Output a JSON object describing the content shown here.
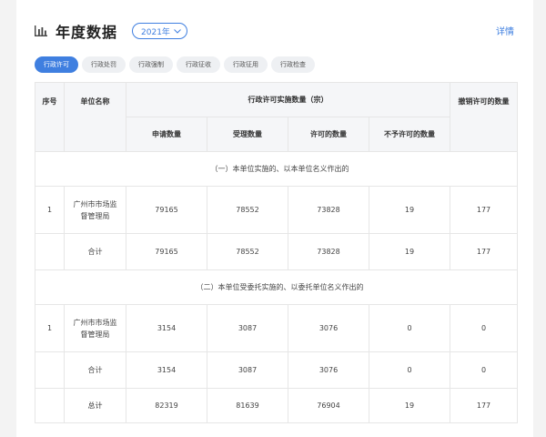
{
  "header": {
    "title": "年度数据",
    "year": "2021年",
    "detail_link": "详情"
  },
  "tabs": [
    {
      "label": "行政许可",
      "active": true
    },
    {
      "label": "行政处罚",
      "active": false
    },
    {
      "label": "行政强制",
      "active": false
    },
    {
      "label": "行政征收",
      "active": false
    },
    {
      "label": "行政征用",
      "active": false
    },
    {
      "label": "行政检查",
      "active": false
    }
  ],
  "table": {
    "headers": {
      "seq": "序号",
      "unit": "单位名称",
      "group": "行政许可实施数量（宗）",
      "apply": "申请数量",
      "accept": "受理数量",
      "permit": "许可的数量",
      "deny": "不予许可的数量",
      "revoke": "撤销许可的数量"
    },
    "sections": [
      {
        "title": "（一）本单位实施的、以本单位名义作出的",
        "row": {
          "seq": "1",
          "unit": "广州市市场监督管理局",
          "apply": "79165",
          "accept": "78552",
          "permit": "73828",
          "deny": "19",
          "revoke": "177"
        },
        "subtotal": {
          "label": "合计",
          "apply": "79165",
          "accept": "78552",
          "permit": "73828",
          "deny": "19",
          "revoke": "177"
        }
      },
      {
        "title": "（二）本单位受委托实施的、以委托单位名义作出的",
        "row": {
          "seq": "1",
          "unit": "广州市市场监督管理局",
          "apply": "3154",
          "accept": "3087",
          "permit": "3076",
          "deny": "0",
          "revoke": "0"
        },
        "subtotal": {
          "label": "合计",
          "apply": "3154",
          "accept": "3087",
          "permit": "3076",
          "deny": "0",
          "revoke": "0"
        }
      }
    ],
    "total": {
      "label": "总计",
      "apply": "82319",
      "accept": "81639",
      "permit": "76904",
      "deny": "19",
      "revoke": "177"
    }
  },
  "colors": {
    "accent": "#3f7fe0",
    "header_bg": "#f5f6f8",
    "border": "#e6e6e6"
  }
}
